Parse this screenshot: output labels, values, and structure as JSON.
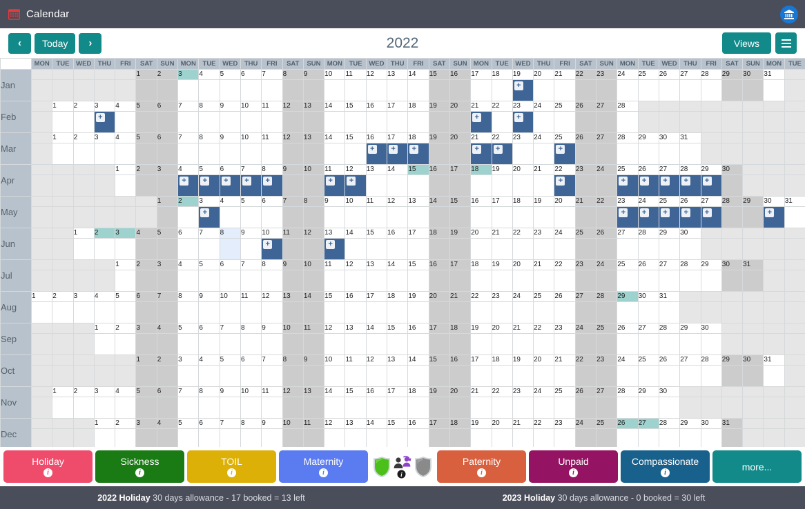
{
  "titlebar": {
    "icon": "calendar-icon",
    "title": "Calendar",
    "avatar_icon": "bank-icon"
  },
  "toolbar": {
    "prev_label": "‹",
    "today_label": "Today",
    "next_label": "›",
    "year": "2022",
    "views_label": "Views",
    "menu_icon": "hamburger-icon"
  },
  "grid": {
    "weekday_start_index": 0,
    "weekdays": [
      "MON",
      "TUE",
      "WED",
      "THU",
      "FRI",
      "SAT",
      "SUN"
    ],
    "day_columns": 37,
    "month_labels": [
      "Jan",
      "Feb",
      "Mar",
      "Apr",
      "May",
      "Jun",
      "Jul",
      "Aug",
      "Sep",
      "Oct",
      "Nov",
      "Dec"
    ],
    "months": [
      {
        "name": "Jan",
        "offset": 5,
        "days": 31,
        "booked": [
          19
        ],
        "holidays": [
          3
        ],
        "today": null
      },
      {
        "name": "Feb",
        "offset": 1,
        "days": 28,
        "booked": [
          3,
          21,
          23
        ],
        "holidays": [],
        "today": null
      },
      {
        "name": "Mar",
        "offset": 1,
        "days": 31,
        "booked": [
          16,
          17,
          18,
          21,
          22,
          25
        ],
        "holidays": [],
        "today": null
      },
      {
        "name": "Apr",
        "offset": 4,
        "days": 30,
        "booked": [
          4,
          5,
          6,
          7,
          8,
          11,
          12,
          22,
          25,
          26,
          27,
          28,
          29
        ],
        "holidays": [
          15,
          18
        ],
        "today": null
      },
      {
        "name": "May",
        "offset": 6,
        "days": 31,
        "booked": [
          3,
          23,
          24,
          25,
          26,
          27,
          30
        ],
        "holidays": [
          2
        ],
        "today": null
      },
      {
        "name": "Jun",
        "offset": 2,
        "days": 30,
        "booked": [
          10,
          13
        ],
        "holidays": [
          2,
          3
        ],
        "today": 8
      },
      {
        "name": "Jul",
        "offset": 4,
        "days": 31,
        "booked": [],
        "holidays": [],
        "today": null
      },
      {
        "name": "Aug",
        "offset": 0,
        "days": 31,
        "booked": [],
        "holidays": [
          29
        ],
        "today": null
      },
      {
        "name": "Sep",
        "offset": 3,
        "days": 30,
        "booked": [],
        "holidays": [],
        "today": null
      },
      {
        "name": "Oct",
        "offset": 5,
        "days": 31,
        "booked": [],
        "holidays": [],
        "today": null
      },
      {
        "name": "Nov",
        "offset": 1,
        "days": 30,
        "booked": [],
        "holidays": [],
        "today": null
      },
      {
        "name": "Dec",
        "offset": 3,
        "days": 31,
        "booked": [],
        "holidays": [
          26,
          27
        ],
        "today": null
      }
    ],
    "colors": {
      "booked": "#3f6596",
      "holiday": "#9ed2ce",
      "weekend": "#cccccc",
      "outside": "#e6e6e6",
      "today": "#e3edfb",
      "header": "#b7c2cc"
    }
  },
  "legend": {
    "info_glyph": "i",
    "buttons": [
      {
        "label": "Holiday",
        "color": "#ef4b6b"
      },
      {
        "label": "Sickness",
        "color": "#1a7a14"
      },
      {
        "label": "TOIL",
        "color": "#ddb007"
      },
      {
        "label": "Maternity",
        "color": "#5b7cf0"
      },
      {
        "label": "Paternity",
        "color": "#d9603f"
      },
      {
        "label": "Unpaid",
        "color": "#941362"
      },
      {
        "label": "Compassionate",
        "color": "#19618d"
      }
    ],
    "icons": [
      {
        "name": "green-shield-icon",
        "color": "#4bbf1a"
      },
      {
        "name": "team-people-icon",
        "color": "#8e44c9"
      },
      {
        "name": "grey-shield-icon",
        "color": "#8a8a8a"
      }
    ],
    "more_label": "more...",
    "more_color": "#128a8a"
  },
  "footer": {
    "left": {
      "title": "2022 Holiday",
      "detail": "30 days allowance - 17 booked = 13 left"
    },
    "right": {
      "title": "2023 Holiday",
      "detail": "30 days allowance - 0 booked = 30 left"
    }
  }
}
